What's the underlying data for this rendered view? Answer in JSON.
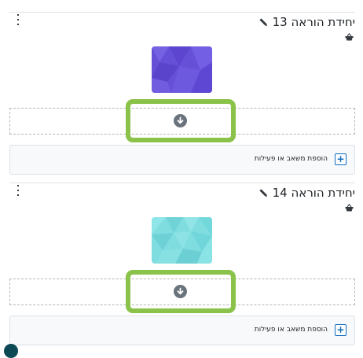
{
  "units": [
    {
      "title": "יחידת הוראה 13",
      "add_label": "הוספת משאב או פעילות",
      "thumb_theme": "purple"
    },
    {
      "title": "יחידת הוראה 14",
      "add_label": "הוספת משאב או פעילות",
      "thumb_theme": "cyan"
    }
  ],
  "icons": {
    "kebab": "kebab-menu-icon",
    "edit": "pencil-icon",
    "basket": "basket-icon",
    "drop": "arrow-down-circle-icon",
    "add": "plus-icon"
  },
  "colors": {
    "highlight": "#8bc34a",
    "primary": "#0f6cbf",
    "thumb_purple": "#6750d8",
    "thumb_cyan": "#7fdde0",
    "drop_icon": "#6a737b"
  }
}
